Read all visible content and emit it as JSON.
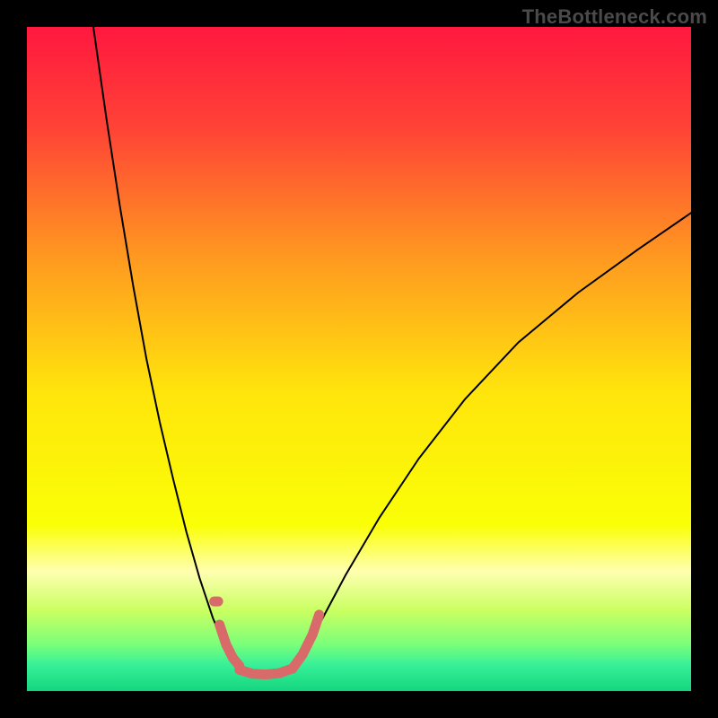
{
  "watermark": "TheBottleneck.com",
  "chart_data": {
    "type": "line",
    "title": "",
    "xlabel": "",
    "ylabel": "",
    "xlim": [
      0,
      100
    ],
    "ylim": [
      0,
      100
    ],
    "grid": false,
    "legend": false,
    "gradient_stops": [
      {
        "offset": 0.0,
        "color": "#ff183f"
      },
      {
        "offset": 0.15,
        "color": "#ff4236"
      },
      {
        "offset": 0.35,
        "color": "#ff9a20"
      },
      {
        "offset": 0.55,
        "color": "#ffe50c"
      },
      {
        "offset": 0.75,
        "color": "#faff06"
      },
      {
        "offset": 0.82,
        "color": "#ffffb0"
      },
      {
        "offset": 0.88,
        "color": "#c8ff60"
      },
      {
        "offset": 0.93,
        "color": "#7aff7a"
      },
      {
        "offset": 0.96,
        "color": "#38f098"
      },
      {
        "offset": 1.0,
        "color": "#14d67e"
      }
    ],
    "series": [
      {
        "name": "left-arm",
        "stroke": "#000000",
        "stroke_width": 2,
        "x": [
          10.0,
          12.0,
          14.0,
          16.0,
          18.0,
          20.0,
          22.0,
          24.0,
          26.0,
          28.0,
          29.5,
          31.0
        ],
        "y": [
          100.0,
          86.0,
          73.0,
          61.0,
          50.0,
          40.5,
          32.0,
          24.0,
          17.0,
          11.0,
          7.5,
          5.0
        ]
      },
      {
        "name": "right-arm",
        "stroke": "#000000",
        "stroke_width": 2,
        "x": [
          41.0,
          44.0,
          48.0,
          53.0,
          59.0,
          66.0,
          74.0,
          83.0,
          92.0,
          100.0
        ],
        "y": [
          5.0,
          10.0,
          17.5,
          26.0,
          35.0,
          44.0,
          52.5,
          60.0,
          66.5,
          72.0
        ]
      },
      {
        "name": "left-thick-overlay",
        "stroke": "#d86a6a",
        "stroke_width": 11,
        "x": [
          29.0,
          30.0,
          31.0,
          32.0
        ],
        "y": [
          10.0,
          7.0,
          5.0,
          3.8
        ]
      },
      {
        "name": "left-dot-overlay",
        "stroke": "#d86a6a",
        "stroke_width": 11,
        "x": [
          28.2,
          28.8
        ],
        "y": [
          13.5,
          13.5
        ]
      },
      {
        "name": "bottom-flat-overlay",
        "stroke": "#d86a6a",
        "stroke_width": 11,
        "x": [
          32.0,
          34.0,
          36.0,
          38.0,
          40.0
        ],
        "y": [
          3.2,
          2.6,
          2.5,
          2.7,
          3.4
        ]
      },
      {
        "name": "right-thick-overlay",
        "stroke": "#d86a6a",
        "stroke_width": 11,
        "x": [
          40.0,
          41.5,
          43.0,
          44.0
        ],
        "y": [
          3.4,
          5.5,
          8.5,
          11.5
        ]
      }
    ]
  }
}
